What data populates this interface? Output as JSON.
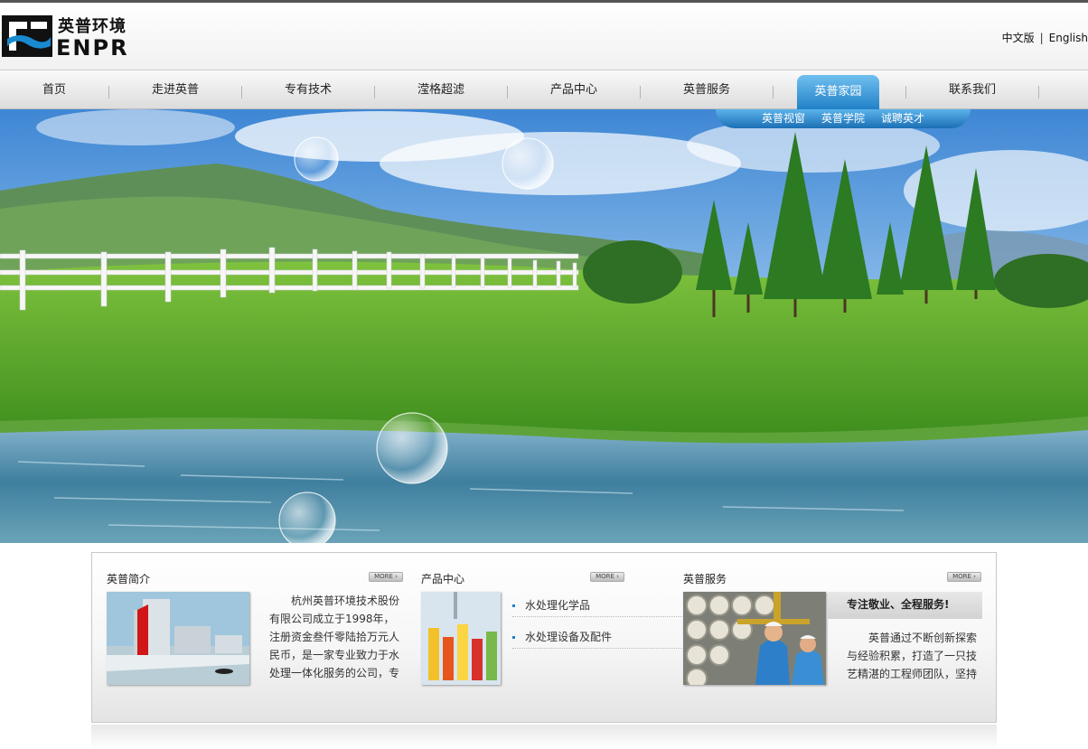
{
  "header": {
    "logo_cn": "英普环境",
    "logo_en": "ENPR",
    "lang_cn": "中文版",
    "lang_sep": "|",
    "lang_en": "English"
  },
  "nav": {
    "items": [
      "首页",
      "走进英普",
      "专有技术",
      "滢格超滤",
      "产品中心",
      "英普服务",
      "英普家园",
      "联系我们"
    ],
    "active": "英普家园",
    "subnav": [
      "英普视窗",
      "英普学院",
      "诚聘英才"
    ]
  },
  "colors": {
    "accent": "#1f7fc6",
    "active_tab_top": "#6fc0ef",
    "nav_bg": "#e8e8e8"
  },
  "intro": {
    "title": "英普简介",
    "more": "MORE ›",
    "text": "杭州英普环境技术股份有限公司成立于1998年，注册资金叁仟零陆拾万元人民币，是一家专业致力于水处理一体化服务的公司，专业"
  },
  "products": {
    "title": "产品中心",
    "more": "MORE ›",
    "items": [
      "水处理化学品",
      "水处理设备及配件"
    ]
  },
  "service": {
    "title": "英普服务",
    "more": "MORE ›",
    "headline": "专注敬业、全程服务!",
    "text": "英普通过不断创新探索与经验积累，打造了一只技艺精湛的工程师团队，坚持"
  }
}
